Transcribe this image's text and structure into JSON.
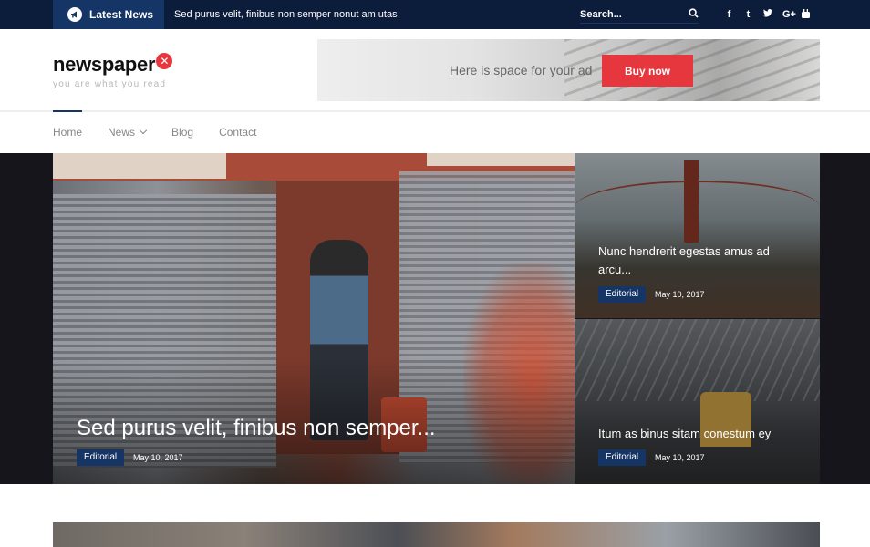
{
  "topbar": {
    "latest_label": "Latest News",
    "ticker_text": "Sed purus velit, finibus non semper nonut am utas",
    "search_placeholder": "Search...",
    "social": [
      {
        "icon": "facebook-icon",
        "glyph": "f"
      },
      {
        "icon": "tumblr-icon",
        "glyph": "t"
      },
      {
        "icon": "twitter-icon",
        "glyph": "🐦"
      },
      {
        "icon": "google-plus-icon",
        "glyph": "G+"
      },
      {
        "icon": "youtube-icon",
        "glyph": "▶"
      }
    ]
  },
  "header": {
    "logo_text": "newspaper",
    "logo_mark": "✕",
    "tagline": "you are what you read",
    "ad_text": "Here is space for your ad",
    "ad_button": "Buy now"
  },
  "nav": {
    "items": [
      {
        "label": "Home",
        "active": true
      },
      {
        "label": "News",
        "dropdown": true
      },
      {
        "label": "Blog"
      },
      {
        "label": "Contact"
      }
    ]
  },
  "hero": {
    "main": {
      "title": "Sed purus velit, finibus non semper...",
      "category": "Editorial",
      "date": "May 10, 2017"
    },
    "side": [
      {
        "title": "Nunc hendrerit egestas amus ad arcu...",
        "category": "Editorial",
        "date": "May 10, 2017"
      },
      {
        "title": "Itum as binus sitam conestum ey",
        "category": "Editorial",
        "date": "May 10, 2017"
      }
    ]
  },
  "colors": {
    "topbar": "#0c1c3b",
    "accent_blue": "#143566",
    "accent_red": "#e6373f"
  }
}
